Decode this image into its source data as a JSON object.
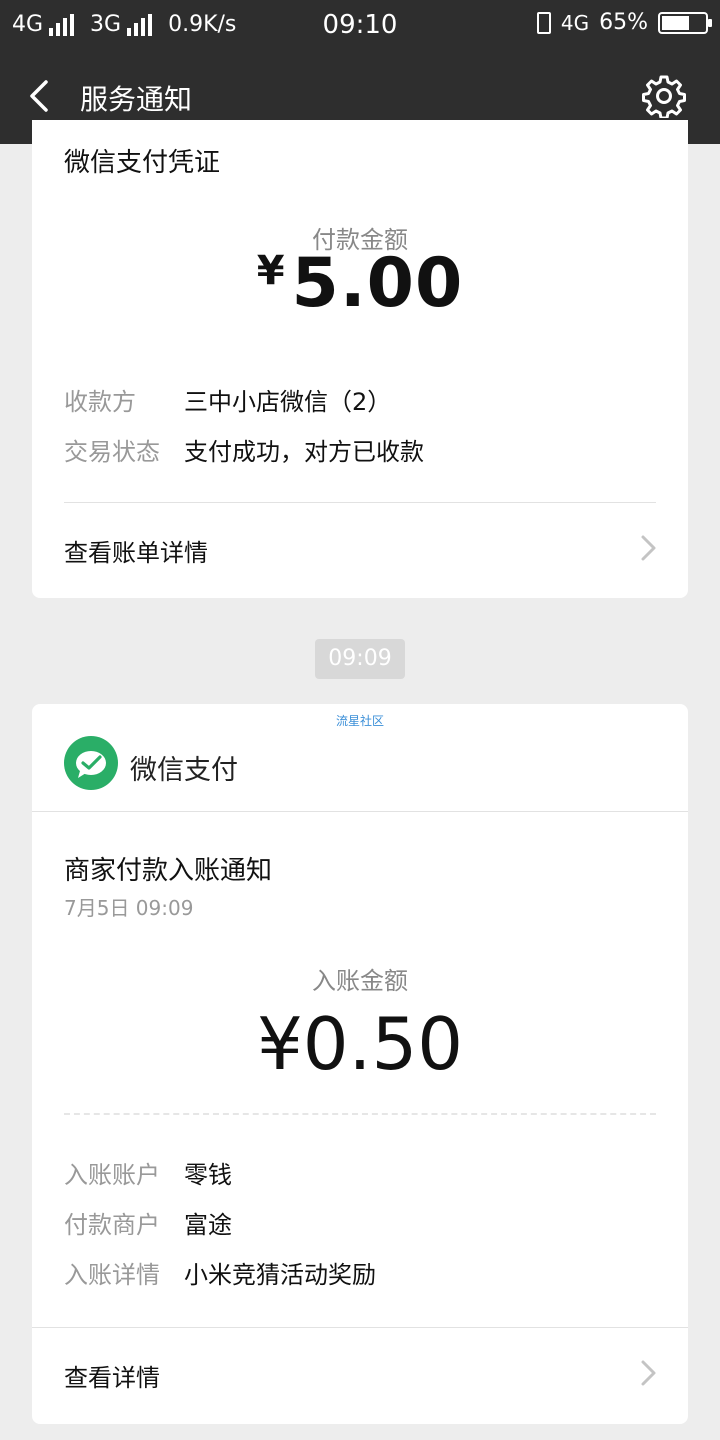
{
  "status_bar": {
    "net1": "4G",
    "net2": "3G",
    "speed": "0.9K/s",
    "time": "09:10",
    "net3": "4G",
    "battery_text": "65%",
    "battery_level": 0.65
  },
  "nav": {
    "title": "服务通知"
  },
  "receipt": {
    "title": "微信支付凭证",
    "amount_label": "付款金额",
    "currency": "¥",
    "amount": "5.00",
    "rows": [
      {
        "key": "收款方",
        "value": "三中小店微信（2）"
      },
      {
        "key": "交易状态",
        "value": "支付成功，对方已收款"
      }
    ],
    "link": "查看账单详情"
  },
  "time_divider": "09:09",
  "notice": {
    "watermark": "流星社区",
    "brand": "微信支付",
    "title": "商家付款入账通知",
    "date": "7月5日  09:09",
    "amount_label": "入账金额",
    "amount": "¥0.50",
    "rows": [
      {
        "key": "入账账户",
        "value": "零钱"
      },
      {
        "key": "付款商户",
        "value": "富途"
      },
      {
        "key": "入账详情",
        "value": "小米竞猜活动奖励"
      }
    ],
    "link": "查看详情"
  },
  "colors": {
    "header": "#2e2e2e",
    "background": "#ededed",
    "wechat_green": "#2aae67"
  }
}
